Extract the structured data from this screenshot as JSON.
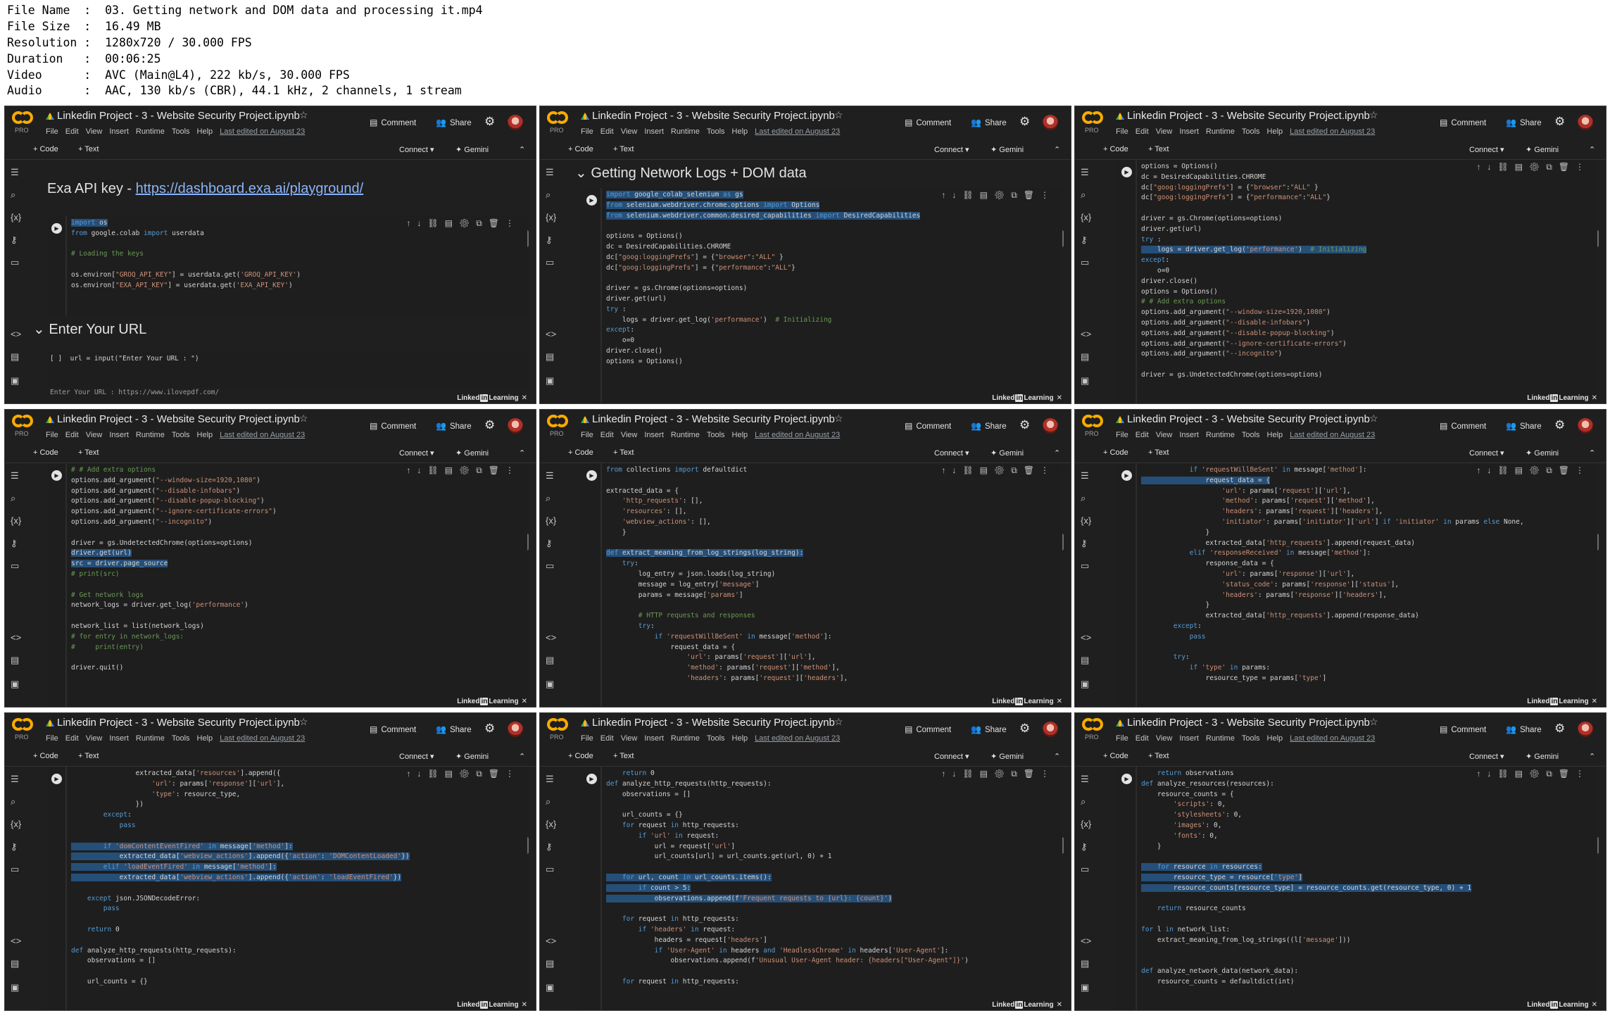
{
  "meta": {
    "lines": [
      "File Name  :  03. Getting network and DOM data and processing it.mp4",
      "File Size  :  16.49 MB",
      "Resolution :  1280x720 / 30.000 FPS",
      "Duration   :  00:06:25",
      "Video      :  AVC (Main@L4), 222 kb/s, 30.000 FPS",
      "Audio      :  AAC, 130 kb/s (CBR), 44.1 kHz, 2 channels, 1 stream"
    ]
  },
  "app": {
    "title": "Linkedin Project - 3 - Website Security Project.ipynb",
    "pro": "PRO",
    "menu": [
      "File",
      "Edit",
      "View",
      "Insert",
      "Runtime",
      "Tools",
      "Help"
    ],
    "last_edited": "Last edited on August 23",
    "comment": "Comment",
    "share": "Share",
    "add_code": "+ Code",
    "add_text": "+ Text",
    "connect": "Connect",
    "gemini": "Gemini",
    "watermark_pre": "Linked",
    "watermark_in": "in",
    "watermark_post": "Learning",
    "colors": {
      "bg": "#1f1f1f",
      "accent": "#f9ab00",
      "keyword": "#569cd6",
      "string": "#ce9178",
      "comment": "#6a9955",
      "selection": "#264f78"
    }
  },
  "cells": [
    {
      "md_title_prefix": "Exa API key - ",
      "md_link": "https://dashboard.exa.ai/playground/",
      "code": [
        "import os",
        "from google.colab import userdata",
        "",
        "# Loading the keys",
        "",
        "os.environ[\"GROQ_API_KEY\"] = userdata.get('GROQ_API_KEY')",
        "os.environ[\"EXA_API_KEY\"] = userdata.get('EXA_API_KEY')"
      ],
      "section": "Enter Your URL",
      "input_line": "[ ]  url = input(\"Enter Your URL : \")",
      "output_line": "Enter Your URL : https://www.ilovepdf.com/"
    },
    {
      "section": "Getting Network Logs + DOM data",
      "code": [
        "import google_colab_selenium as gs",
        "from selenium.webdriver.chrome.options import Options",
        "from selenium.webdriver.common.desired_capabilities import DesiredCapabilities",
        "",
        "options = Options()",
        "dc = DesiredCapabilities.CHROME",
        "dc[\"goog:loggingPrefs\"] = {\"browser\":\"ALL\" }",
        "dc[\"goog:loggingPrefs\"] = {\"performance\":\"ALL\"}",
        "",
        "driver = gs.Chrome(options=options)",
        "driver.get(url)",
        "try :",
        "    logs = driver.get_log('performance')  # Initializing",
        "except:",
        "    o=0",
        "driver.close()",
        "options = Options()"
      ]
    },
    {
      "code": [
        "options = Options()",
        "dc = DesiredCapabilities.CHROME",
        "dc[\"goog:loggingPrefs\"] = {\"browser\":\"ALL\" }",
        "dc[\"goog:loggingPrefs\"] = {\"performance\":\"ALL\"}",
        "",
        "driver = gs.Chrome(options=options)",
        "driver.get(url)",
        "try :",
        "    logs = driver.get_log('performance')  # Initializing",
        "except:",
        "    o=0",
        "driver.close()",
        "options = Options()",
        "# # Add extra options",
        "options.add_argument(\"--window-size=1920,1080\")",
        "options.add_argument(\"--disable-infobars\")",
        "options.add_argument(\"--disable-popup-blocking\")",
        "options.add_argument(\"--ignore-certificate-errors\")",
        "options.add_argument(\"--incognito\")",
        "",
        "driver = gs.UndetectedChrome(options=options)"
      ]
    },
    {
      "code": [
        "# # Add extra options",
        "options.add_argument(\"--window-size=1920,1080\")",
        "options.add_argument(\"--disable-infobars\")",
        "options.add_argument(\"--disable-popup-blocking\")",
        "options.add_argument(\"--ignore-certificate-errors\")",
        "options.add_argument(\"--incognito\")",
        "",
        "driver = gs.UndetectedChrome(options=options)",
        "driver.get(url)",
        "src = driver.page_source",
        "# print(src)",
        "",
        "# Get network logs",
        "network_logs = driver.get_log('performance')",
        "",
        "network_list = list(network_logs)",
        "# for entry in network_logs:",
        "#     print(entry)",
        "",
        "driver.quit()"
      ]
    },
    {
      "code": [
        "from collections import defaultdict",
        "",
        "extracted_data = {",
        "    'http_requests': [],",
        "    'resources': [],",
        "    'webview_actions': [],",
        "    }",
        "",
        "def extract_meaning_from_log_strings(log_string):",
        "    try:",
        "        log_entry = json.loads(log_string)",
        "        message = log_entry['message']",
        "        params = message['params']",
        "",
        "        # HTTP requests and responses",
        "        try:",
        "            if 'requestWillBeSent' in message['method']:",
        "                request_data = {",
        "                    'url': params['request']['url'],",
        "                    'method': params['request']['method'],",
        "                    'headers': params['request']['headers'],"
      ]
    },
    {
      "code": [
        "            if 'requestWillBeSent' in message['method']:",
        "                request_data = {",
        "                    'url': params['request']['url'],",
        "                    'method': params['request']['method'],",
        "                    'headers': params['request']['headers'],",
        "                    'initiator': params['initiator']['url'] if 'initiator' in params else None,",
        "                }",
        "                extracted_data['http_requests'].append(request_data)",
        "            elif 'responseReceived' in message['method']:",
        "                response_data = {",
        "                    'url': params['response']['url'],",
        "                    'status_code': params['response']['status'],",
        "                    'headers': params['response']['headers'],",
        "                }",
        "                extracted_data['http_requests'].append(response_data)",
        "        except:",
        "            pass",
        "",
        "        try:",
        "            if 'type' in params:",
        "                resource_type = params['type']"
      ]
    },
    {
      "code": [
        "                extracted_data['resources'].append({",
        "                    'url': params['response']['url'],",
        "                    'type': resource_type,",
        "                })",
        "        except:",
        "            pass",
        "",
        "        if 'domContentEventFired' in message['method']:",
        "            extracted_data['webview_actions'].append({'action': 'DOMContentLoaded'})",
        "        elif 'loadEventFired' in message['method']:",
        "            extracted_data['webview_actions'].append({'action': 'loadEventFired'})",
        "",
        "    except json.JSONDecodeError:",
        "        pass",
        "",
        "    return 0",
        "",
        "def analyze_http_requests(http_requests):",
        "    observations = []",
        "",
        "    url_counts = {}"
      ]
    },
    {
      "code": [
        "    return 0",
        "def analyze_http_requests(http_requests):",
        "    observations = []",
        "",
        "    url_counts = {}",
        "    for request in http_requests:",
        "        if 'url' in request:",
        "            url = request['url']",
        "            url_counts[url] = url_counts.get(url, 0) + 1",
        "",
        "    for url, count in url_counts.items():",
        "        if count > 5:",
        "            observations.append(f'Frequent requests to {url}: {count}')",
        "",
        "    for request in http_requests:",
        "        if 'headers' in request:",
        "            headers = request['headers']",
        "            if 'User-Agent' in headers and 'HeadlessChrome' in headers['User-Agent']:",
        "                observations.append(f'Unusual User-Agent header: {headers[\"User-Agent\"]}')",
        "",
        "    for request in http_requests:"
      ]
    },
    {
      "code": [
        "    return observations",
        "def analyze_resources(resources):",
        "    resource_counts = {",
        "        'scripts': 0,",
        "        'stylesheets': 0,",
        "        'images': 0,",
        "        'fonts': 0,",
        "    }",
        "",
        "    for resource in resources:",
        "        resource_type = resource['type']",
        "        resource_counts[resource_type] = resource_counts.get(resource_type, 0) + 1",
        "",
        "    return resource_counts",
        "",
        "for l in network_list:",
        "    extract_meaning_from_log_strings((l['message']))",
        "",
        "",
        "def analyze_network_data(network_data):",
        "    resource_counts = defaultdict(int)"
      ]
    }
  ]
}
